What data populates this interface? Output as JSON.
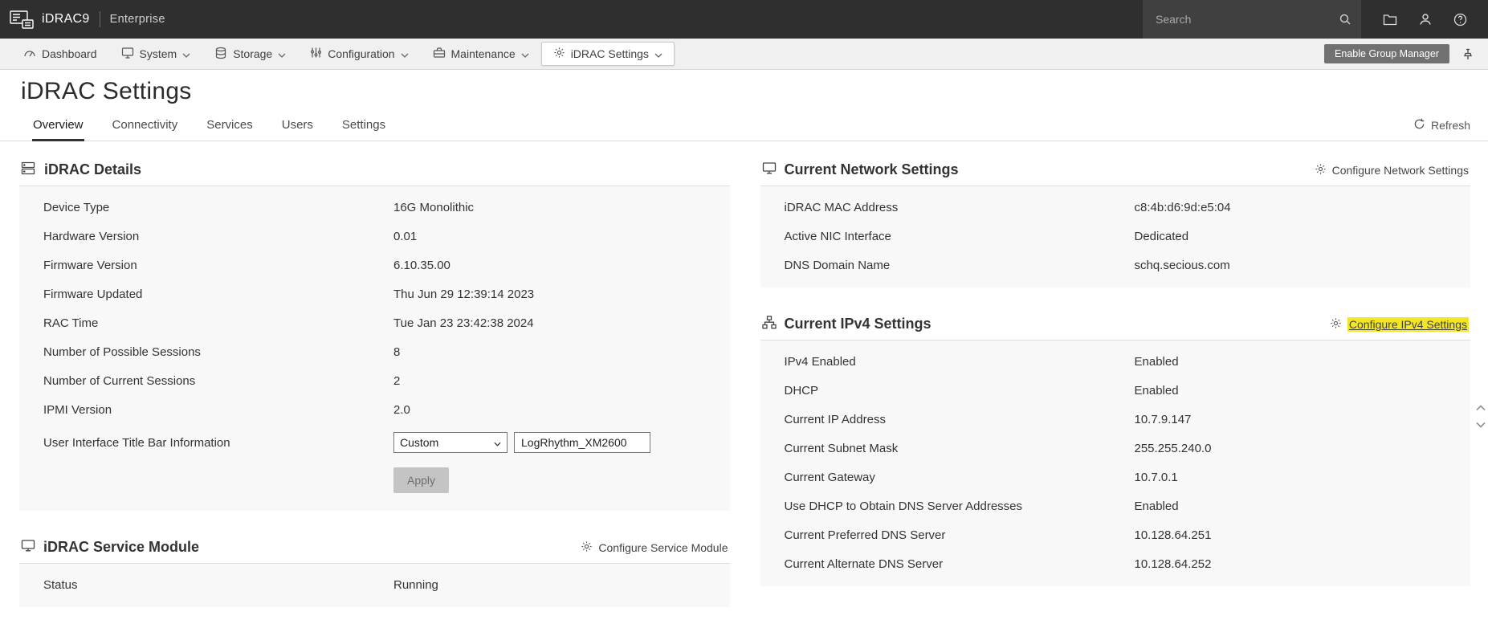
{
  "topbar": {
    "brand": "iDRAC9",
    "edition": "Enterprise",
    "search_placeholder": "Search"
  },
  "nav": {
    "items": [
      {
        "label": "Dashboard"
      },
      {
        "label": "System"
      },
      {
        "label": "Storage"
      },
      {
        "label": "Configuration"
      },
      {
        "label": "Maintenance"
      },
      {
        "label": "iDRAC Settings"
      }
    ],
    "group_manager_label": "Enable Group Manager"
  },
  "page": {
    "title": "iDRAC Settings",
    "tabs": [
      {
        "label": "Overview"
      },
      {
        "label": "Connectivity"
      },
      {
        "label": "Services"
      },
      {
        "label": "Users"
      },
      {
        "label": "Settings"
      }
    ],
    "refresh_label": "Refresh"
  },
  "panels": {
    "idrac_details": {
      "title": "iDRAC Details",
      "rows": [
        {
          "label": "Device Type",
          "value": "16G Monolithic"
        },
        {
          "label": "Hardware Version",
          "value": "0.01"
        },
        {
          "label": "Firmware Version",
          "value": "6.10.35.00"
        },
        {
          "label": "Firmware Updated",
          "value": "Thu Jun 29 12:39:14 2023"
        },
        {
          "label": "RAC Time",
          "value": "Tue Jan 23 23:42:38 2024"
        },
        {
          "label": "Number of Possible Sessions",
          "value": "8"
        },
        {
          "label": "Number of Current Sessions",
          "value": "2"
        },
        {
          "label": "IPMI Version",
          "value": "2.0"
        }
      ],
      "title_bar": {
        "label": "User Interface Title Bar Information",
        "select_value": "Custom",
        "input_value": "LogRhythm_XM2600",
        "apply_label": "Apply"
      }
    },
    "service_module": {
      "title": "iDRAC Service Module",
      "action_label": "Configure Service Module",
      "rows": [
        {
          "label": "Status",
          "value": "Running"
        }
      ]
    },
    "network_settings": {
      "title": "Current Network Settings",
      "action_label": "Configure Network Settings",
      "rows": [
        {
          "label": "iDRAC MAC Address",
          "value": "c8:4b:d6:9d:e5:04"
        },
        {
          "label": "Active NIC Interface",
          "value": "Dedicated"
        },
        {
          "label": "DNS Domain Name",
          "value": "schq.secious.com"
        }
      ]
    },
    "ipv4_settings": {
      "title": "Current IPv4 Settings",
      "action_label": "Configure IPv4 Settings",
      "action_highlighted": true,
      "rows": [
        {
          "label": "IPv4 Enabled",
          "value": "Enabled"
        },
        {
          "label": "DHCP",
          "value": "Enabled"
        },
        {
          "label": "Current IP Address",
          "value": "10.7.9.147"
        },
        {
          "label": "Current Subnet Mask",
          "value": "255.255.240.0"
        },
        {
          "label": "Current Gateway",
          "value": "10.7.0.1"
        },
        {
          "label": "Use DHCP to Obtain DNS Server Addresses",
          "value": "Enabled"
        },
        {
          "label": "Current Preferred DNS Server",
          "value": "10.128.64.251"
        },
        {
          "label": "Current Alternate DNS Server",
          "value": "10.128.64.252"
        }
      ]
    }
  },
  "colors": {
    "topbar_background": "#2f2f2f",
    "highlight_yellow": "#f2e722",
    "active_tab_underline": "#333333"
  }
}
